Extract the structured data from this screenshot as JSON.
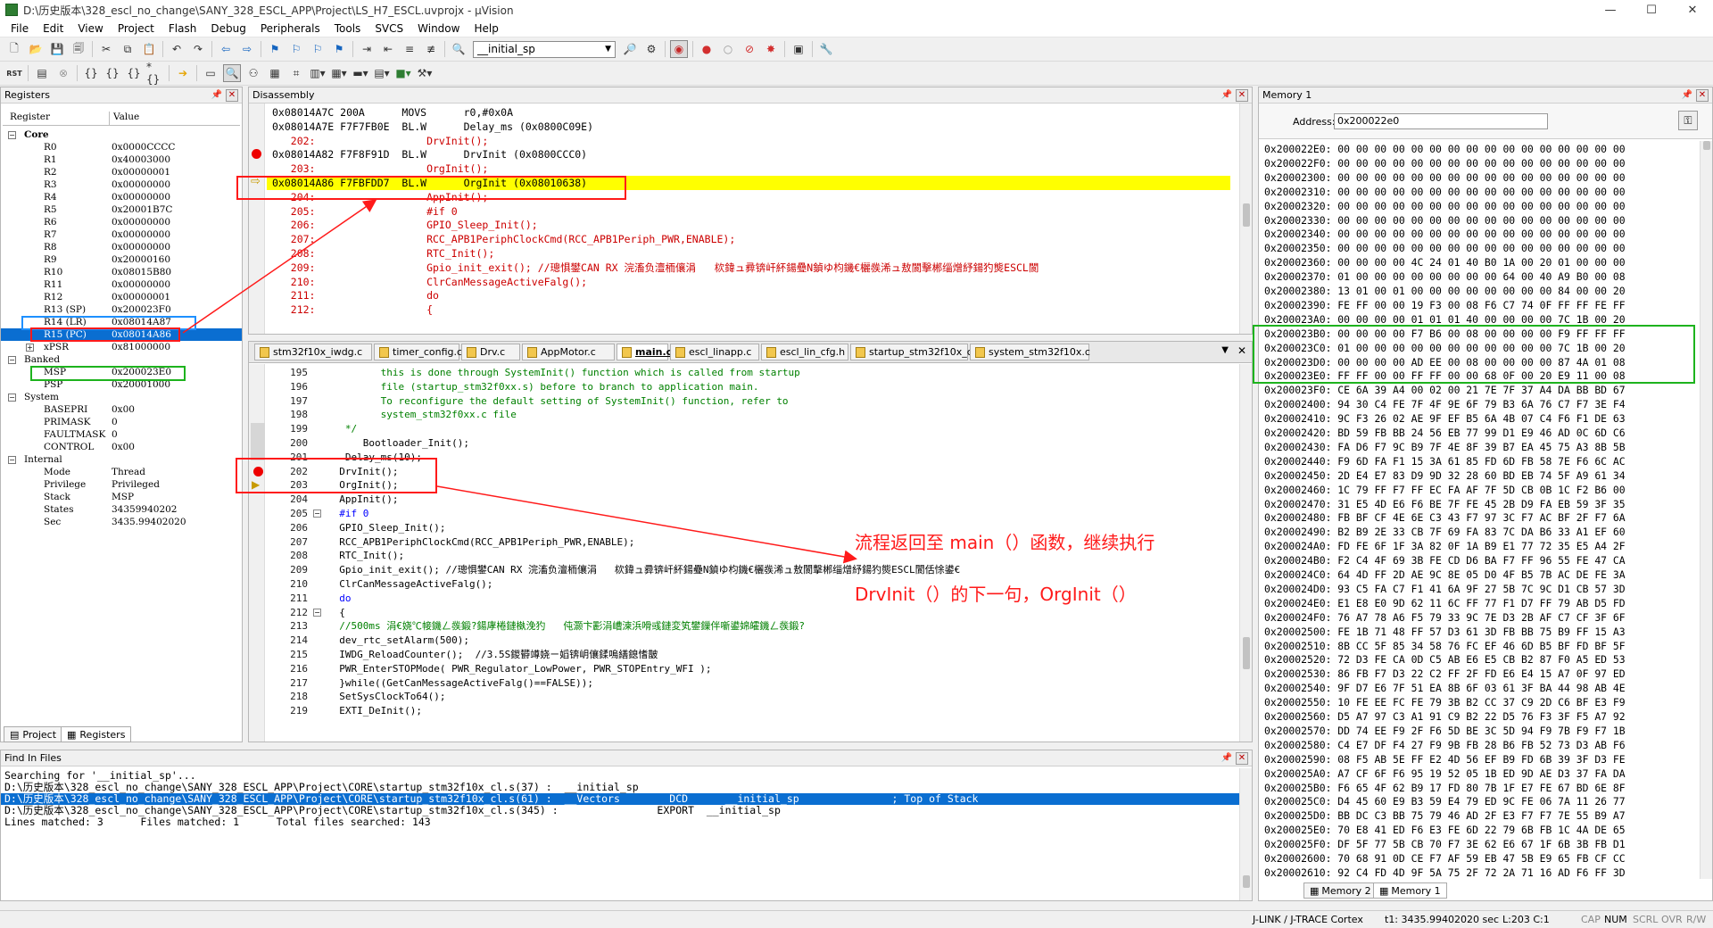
{
  "window": {
    "title": "D:\\历史版本\\328_escl_no_change\\SANY_328_ESCL_APP\\Project\\LS_H7_ESCL.uvprojx - µVision",
    "minimize": "—",
    "maximize": "☐",
    "close": "✕"
  },
  "menu": [
    "File",
    "Edit",
    "View",
    "Project",
    "Flash",
    "Debug",
    "Peripherals",
    "Tools",
    "SVCS",
    "Window",
    "Help"
  ],
  "toolbar": {
    "symbol_combo": "__initial_sp"
  },
  "registers": {
    "title": "Registers",
    "col_register": "Register",
    "col_value": "Value",
    "rows": [
      {
        "name": "Core",
        "value": "",
        "indent": 0,
        "expander": "−",
        "bold": true
      },
      {
        "name": "R0",
        "value": "0x0000CCCC",
        "indent": 2
      },
      {
        "name": "R1",
        "value": "0x40003000",
        "indent": 2
      },
      {
        "name": "R2",
        "value": "0x00000001",
        "indent": 2
      },
      {
        "name": "R3",
        "value": "0x00000000",
        "indent": 2
      },
      {
        "name": "R4",
        "value": "0x00000000",
        "indent": 2
      },
      {
        "name": "R5",
        "value": "0x20001B7C",
        "indent": 2
      },
      {
        "name": "R6",
        "value": "0x00000000",
        "indent": 2
      },
      {
        "name": "R7",
        "value": "0x00000000",
        "indent": 2
      },
      {
        "name": "R8",
        "value": "0x00000000",
        "indent": 2
      },
      {
        "name": "R9",
        "value": "0x20000160",
        "indent": 2
      },
      {
        "name": "R10",
        "value": "0x08015B80",
        "indent": 2
      },
      {
        "name": "R11",
        "value": "0x00000000",
        "indent": 2
      },
      {
        "name": "R12",
        "value": "0x00000001",
        "indent": 2
      },
      {
        "name": "R13 (SP)",
        "value": "0x200023F0",
        "indent": 2
      },
      {
        "name": "R14 (LR)",
        "value": "0x08014A87",
        "indent": 2
      },
      {
        "name": "R15 (PC)",
        "value": "0x08014A86",
        "indent": 2,
        "selected": true
      },
      {
        "name": "xPSR",
        "value": "0x81000000",
        "indent": 2,
        "expander": "+"
      },
      {
        "name": "Banked",
        "value": "",
        "indent": 0,
        "expander": "−"
      },
      {
        "name": "MSP",
        "value": "0x200023E0",
        "indent": 2
      },
      {
        "name": "PSP",
        "value": "0x20001000",
        "indent": 2
      },
      {
        "name": "System",
        "value": "",
        "indent": 0,
        "expander": "−"
      },
      {
        "name": "BASEPRI",
        "value": "0x00",
        "indent": 2
      },
      {
        "name": "PRIMASK",
        "value": "0",
        "indent": 2
      },
      {
        "name": "FAULTMASK",
        "value": "0",
        "indent": 2
      },
      {
        "name": "CONTROL",
        "value": "0x00",
        "indent": 2
      },
      {
        "name": "Internal",
        "value": "",
        "indent": 0,
        "expander": "−"
      },
      {
        "name": "Mode",
        "value": "Thread",
        "indent": 2
      },
      {
        "name": "Privilege",
        "value": "Privileged",
        "indent": 2
      },
      {
        "name": "Stack",
        "value": "MSP",
        "indent": 2
      },
      {
        "name": "States",
        "value": "34359940202",
        "indent": 2
      },
      {
        "name": "Sec",
        "value": "3435.99402020",
        "indent": 2
      }
    ],
    "tab_project": "Project",
    "tab_registers": "Registers"
  },
  "disassembly": {
    "title": "Disassembly",
    "lines": [
      {
        "text": "0x08014A7C 200A      MOVS      r0,#0x0A",
        "kind": "asm"
      },
      {
        "text": "0x08014A7E F7F7FB0E  BL.W      Delay_ms (0x0800C09E)",
        "kind": "asm"
      },
      {
        "text": "   202:                  DrvInit();",
        "kind": "src"
      },
      {
        "text": "0x08014A82 F7F8F91D  BL.W      DrvInit (0x0800CCC0)",
        "kind": "asm",
        "bp": true
      },
      {
        "text": "   203:                  OrgInit();",
        "kind": "src"
      },
      {
        "text": "0x08014A86 F7FBFDD7  BL.W      OrgInit (0x08010638)",
        "kind": "asm",
        "current": true
      },
      {
        "text": "   204:                  AppInit();",
        "kind": "src"
      },
      {
        "text": "   205:                  #if 0",
        "kind": "src"
      },
      {
        "text": "   206:                  GPIO_Sleep_Init();",
        "kind": "src"
      },
      {
        "text": "   207:                  RCC_APB1PeriphClockCmd(RCC_APB1Periph_PWR,ENABLE);",
        "kind": "src"
      },
      {
        "text": "   208:                  RTC_Init();",
        "kind": "src"
      },
      {
        "text": "   209:                  Gpio_init_exit(); //璁惧鐢CAN RX 浣滀负澶栭儴涓   栨鍏ュ彛锛屽紑鍚疉N鍞ゆ枃鐖€欐彂浠ュ敖閬擊郴缁熷紓鍚犳熋ESCL閬",
        "kind": "src"
      },
      {
        "text": "   210:                  ClrCanMessageActiveFalg();",
        "kind": "src"
      },
      {
        "text": "   211:                  do",
        "kind": "src"
      },
      {
        "text": "   212:                  {",
        "kind": "src"
      }
    ]
  },
  "tabs": [
    "stm32f10x_iwdg.c",
    "timer_config.c",
    "Drv.c",
    "AppMotor.c",
    "main.c",
    "escl_linapp.c",
    "escl_lin_cfg.h",
    "startup_stm32f10x_cl.s",
    "system_stm32f10x.c"
  ],
  "active_tab": "main.c",
  "source": {
    "lines": [
      {
        "n": "195",
        "text": "         this is done through SystemInit() function which is called from startup",
        "cls": "green"
      },
      {
        "n": "196",
        "text": "         file (startup_stm32f0xx.s) before to branch to application main.",
        "cls": "green"
      },
      {
        "n": "197",
        "text": "         To reconfigure the default setting of SystemInit() function, refer to",
        "cls": "green"
      },
      {
        "n": "198",
        "text": "         system_stm32f0xx.c file",
        "cls": "green"
      },
      {
        "n": "199",
        "text": "   */",
        "cls": "green"
      },
      {
        "n": "200",
        "text": "      Bootloader_Init();",
        "cls": ""
      },
      {
        "n": "201",
        "text": "   Delay_ms(10);",
        "cls": ""
      },
      {
        "n": "202",
        "text": "  DrvInit();",
        "cls": "",
        "bp": true
      },
      {
        "n": "203",
        "text": "  OrgInit();",
        "cls": "",
        "cur": true
      },
      {
        "n": "204",
        "text": "  AppInit();",
        "cls": ""
      },
      {
        "n": "205",
        "text": "  #if 0",
        "cls": "blue",
        "fold": "−"
      },
      {
        "n": "206",
        "text": "  GPIO_Sleep_Init();",
        "cls": ""
      },
      {
        "n": "207",
        "text": "  RCC_APB1PeriphClockCmd(RCC_APB1Periph_PWR,ENABLE);",
        "cls": ""
      },
      {
        "n": "208",
        "text": "  RTC_Init();",
        "cls": ""
      },
      {
        "n": "209",
        "text": "  Gpio_init_exit(); //璁惧鐢CAN RX 浣滀负澶栭儴涓   栨鍏ュ彛锛屽紑鍚疉N鍞ゆ枃鐖€欐彂浠ュ敖閬擊郴缁熷紓鍚犳熋ESCL閬佸悇鍙€",
        "cls": ""
      },
      {
        "n": "210",
        "text": "  ClrCanMessageActiveFalg();",
        "cls": ""
      },
      {
        "n": "211",
        "text": "  do",
        "cls": "blue"
      },
      {
        "n": "212",
        "text": "  {",
        "cls": "",
        "fold": "−"
      },
      {
        "n": "213",
        "text": "  //500ms 涓€娆℃帹鐖ㄥ彂鍛?鍚庨棬鏈槸浼犳   伅灏卞彲涓嶆湅浜嗗彧鏈変笂鐢鏁伴噺鍙婂皬鐖ㄥ彂鍛?",
        "cls": "green"
      },
      {
        "n": "214",
        "text": "  dev_rtc_setAlarm(500);",
        "cls": ""
      },
      {
        "n": "215",
        "text": "  IWDG_ReloadCounter();  //3.5S鍐欎竴娆ㄧ嫍锛岄儴鍒嗚繕鎴愭皵",
        "cls": ""
      },
      {
        "n": "216",
        "text": "  PWR_EnterSTOPMode( PWR_Regulator_LowPower, PWR_STOPEntry_WFI );",
        "cls": ""
      },
      {
        "n": "217",
        "text": "  }while((GetCanMessageActiveFalg()==FALSE));",
        "cls": ""
      },
      {
        "n": "218",
        "text": "  SetSysClockTo64();",
        "cls": ""
      },
      {
        "n": "219",
        "text": "  EXTI_DeInit();",
        "cls": ""
      }
    ]
  },
  "memory": {
    "title": "Memory 1",
    "address_label": "Address:",
    "address_value": "0x200022e0",
    "rows": [
      "0x200022E0: 00 00 00 00 00 00 00 00 00 00 00 00 00 00 00 00",
      "0x200022F0: 00 00 00 00 00 00 00 00 00 00 00 00 00 00 00 00",
      "0x20002300: 00 00 00 00 00 00 00 00 00 00 00 00 00 00 00 00",
      "0x20002310: 00 00 00 00 00 00 00 00 00 00 00 00 00 00 00 00",
      "0x20002320: 00 00 00 00 00 00 00 00 00 00 00 00 00 00 00 00",
      "0x20002330: 00 00 00 00 00 00 00 00 00 00 00 00 00 00 00 00",
      "0x20002340: 00 00 00 00 00 00 00 00 00 00 00 00 00 00 00 00",
      "0x20002350: 00 00 00 00 00 00 00 00 00 00 00 00 00 00 00 00",
      "0x20002360: 00 00 00 00 4C 24 01 40 B0 1A 00 20 01 00 00 00",
      "0x20002370: 01 00 00 00 00 00 00 00 00 64 00 40 A9 B0 00 08",
      "0x20002380: 13 01 00 01 00 00 00 00 00 00 00 00 84 00 00 20",
      "0x20002390: FE FF 00 00 19 F3 00 08 F6 C7 74 0F FF FF FE FF",
      "0x200023A0: 00 00 00 00 01 01 01 40 00 00 00 00 7C 1B 00 20",
      "0x200023B0: 00 00 00 00 F7 B6 00 08 00 00 00 00 F9 FF FF FF",
      "0x200023C0: 01 00 00 00 00 00 00 00 00 00 00 00 7C 1B 00 20",
      "0x200023D0: 00 00 00 00 AD EE 00 08 00 00 00 00 87 4A 01 08",
      "0x200023E0: FF FF 00 00 FF FF 00 00 68 0F 00 20 E9 11 00 08",
      "0x200023F0: CE 6A 39 A4 00 02 00 21 7E 7F 37 A4 DA BB BD 67",
      "0x20002400: 94 30 C4 FE 7F 4F 9E 6F 79 B3 6A 76 C7 F7 3E F4",
      "0x20002410: 9C F3 26 02 AE 9F EF B5 6A 4B 07 C4 F6 F1 DE 63",
      "0x20002420: BD 59 FB BB 24 56 EB 77 99 D1 E9 46 AD 0C 6D C6",
      "0x20002430: FA D6 F7 9C B9 7F 4E 8F 39 B7 EA 45 75 A3 8B 5B",
      "0x20002440: F9 6D FA F1 15 3A 61 85 FD 6D FB 58 7E F6 6C AC",
      "0x20002450: 2D E4 E7 83 D9 9D 32 28 60 BD EB 74 5F A9 61 34",
      "0x20002460: 1C 79 FF F7 FF EC FA AF 7F 5D CB 0B 1C F2 B6 00",
      "0x20002470: 31 E5 4D E6 F6 BE 7F FE 45 2B D9 FA EB 59 3F 35",
      "0x20002480: FB BF CF 4E 6E C3 43 F7 97 3C F7 AC BF 2F F7 6A",
      "0x20002490: B2 B9 2E 33 CB 7F 69 FA 83 7C DA B6 33 A1 EF 60",
      "0x200024A0: FD FE 6F 1F 3A 82 0F 1A B9 E1 77 72 35 E5 A4 2F",
      "0x200024B0: F2 C4 4F 69 3B FE CD D6 BA F7 FF 96 55 FE 47 CA",
      "0x200024C0: 64 4D FF 2D AE 9C 8E 05 D0 4F B5 7B AC DE FE 3A",
      "0x200024D0: 93 C5 FA C7 F1 41 6A 9F 27 5B 7C 9C D1 CB 57 3D",
      "0x200024E0: E1 E8 E0 9D 62 11 6C FF 77 F1 D7 FF 79 AB D5 FD",
      "0x200024F0: 76 A7 78 A6 F5 79 33 9C 7E D3 2B AF C7 CF 3F 6F",
      "0x20002500: FE 1B 71 48 FF 57 D3 61 3D FB BB 75 B9 FF 15 A3",
      "0x20002510: 8B CC 5F 85 34 58 76 FC EF 46 6D B5 BF FD BF 5F",
      "0x20002520: 72 D3 FE CA 0D C5 AB E6 E5 CB B2 87 F0 A5 ED 53",
      "0x20002530: 86 FB F7 D3 22 C2 FF 2F FD E6 E4 15 A7 0F 97 ED",
      "0x20002540: 9F D7 E6 7F 51 EA 8B 6F 03 61 3F BA 44 98 AB 4E",
      "0x20002550: 10 FE EE FC FE 79 3B B2 CC 37 C9 2D C6 BF E3 F9",
      "0x20002560: D5 A7 97 C3 A1 91 C9 B2 22 D5 76 F3 3F F5 A7 92",
      "0x20002570: DD 74 EE F9 2F F6 5D BE 3C 5D 94 F9 7B F9 F7 1B",
      "0x20002580: C4 E7 DF F4 27 F9 9B FB 28 B6 FB 52 73 D3 AB F6",
      "0x20002590: 08 F5 AB 5E FF E2 4D 56 EF B9 FD 6B 39 3F D3 FE",
      "0x200025A0: A7 CF 6F F6 95 19 52 05 1B ED 9D AE D3 37 FA DA",
      "0x200025B0: F6 65 4F 62 B9 17 FD 80 7B 1F E7 FE 67 BD 6E 8F",
      "0x200025C0: D4 45 60 E9 B3 59 E4 79 ED 9C FE 06 7A 11 26 77",
      "0x200025D0: BB DC C3 BB 75 79 46 AD 2F E3 F7 F7 7E 55 B9 A7",
      "0x200025E0: 70 E8 41 ED F6 E3 FE 6D 22 79 6B FB 1C 4A DE 65",
      "0x200025F0: DF 5F 77 5B CB 70 F7 3E 62 E6 67 1F 6B 3B FB D1",
      "0x20002600: 70 68 91 0D CE F7 AF 59 EB 47 5B E9 65 FB CF CC",
      "0x20002610: 92 C4 FD 4D 9F 5A 75 2F 72 2A 71 16 AD F6 FF 3D"
    ],
    "tab_memory2": "Memory 2",
    "tab_memory1": "Memory 1"
  },
  "find": {
    "title": "Find In Files",
    "lines": [
      "Searching for '__initial_sp'...",
      "D:\\历史版本\\328_escl_no_change\\SANY_328_ESCL_APP\\Project\\CORE\\startup_stm32f10x_cl.s(37) :  __initial_sp",
      "D:\\历史版本\\328_escl_no_change\\SANY_328_ESCL_APP\\Project\\CORE\\startup_stm32f10x_cl.s(61) :  __Vectors        DCD      __initial_sp               ; Top of Stack",
      "D:\\历史版本\\328_escl_no_change\\SANY_328_ESCL_APP\\Project\\CORE\\startup_stm32f10x_cl.s(345) :                EXPORT  __initial_sp",
      "Lines matched: 3      Files matched: 1      Total files searched: 143"
    ]
  },
  "annotation": {
    "line1": "流程返回至 main（）函数，继续执行",
    "line2": "DrvInit（）的下一句，OrgInit（）"
  },
  "status": {
    "debugger": "J-LINK / J-TRACE Cortex",
    "time": "t1: 3435.99402020 sec",
    "position": "L:203 C:1",
    "caps": "CAP",
    "num": "NUM",
    "scrl": "SCRL",
    "ovr": "OVR",
    "rw": "R/W"
  },
  "colors": {
    "accent": "#0a6ed1",
    "current_line": "#ffff00",
    "annotation": "#ff1a1a",
    "box_green": "#1db31d",
    "box_blue": "#1e90ff"
  }
}
